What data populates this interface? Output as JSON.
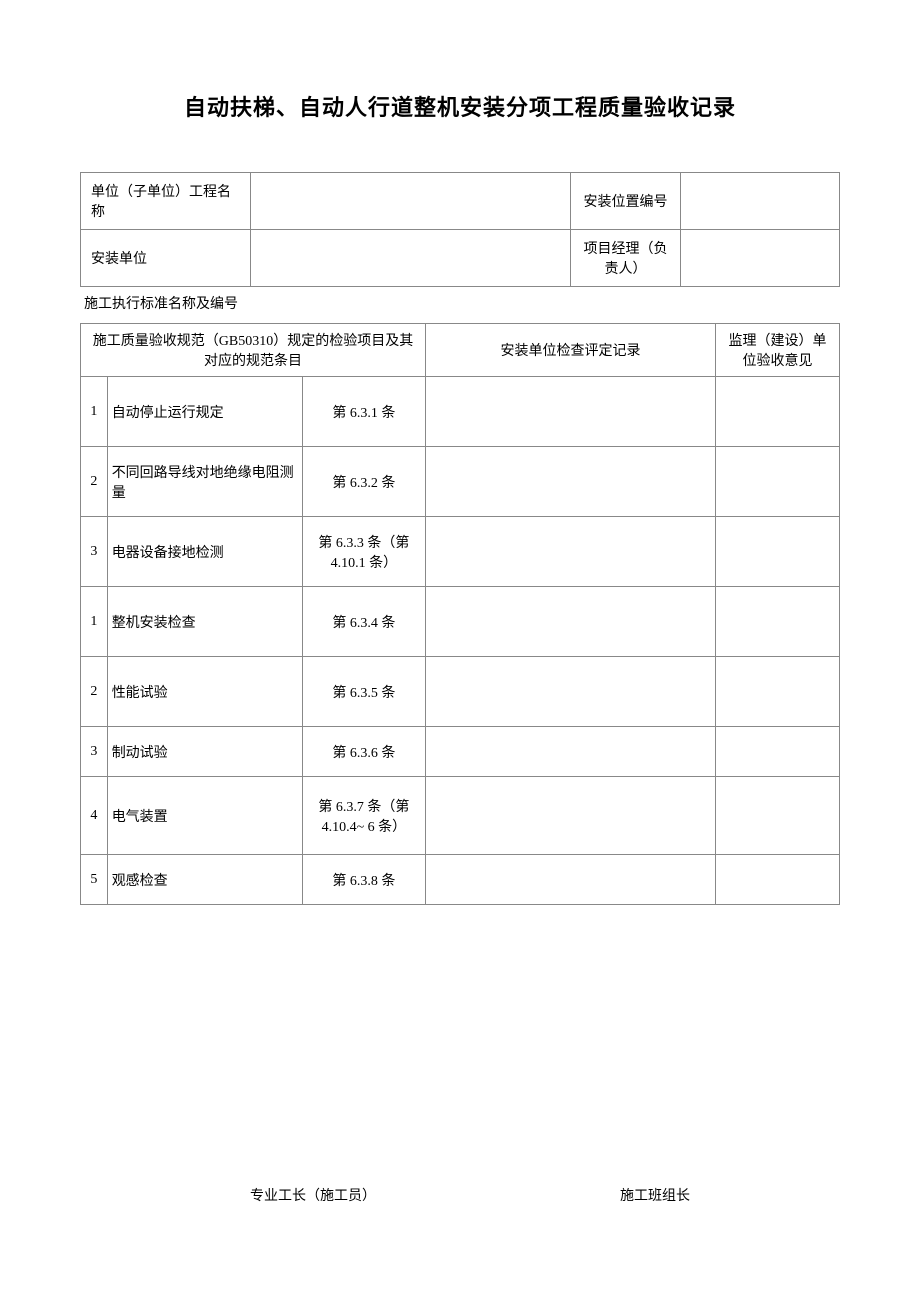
{
  "title": "自动扶梯、自动人行道整机安装分项工程质量验收记录",
  "header": {
    "row1_label1": "单位（子单位）工程名称",
    "row1_value1": "",
    "row1_label2": "安装位置编号",
    "row1_value2": "",
    "row2_label1": "安装单位",
    "row2_value1": "",
    "row2_label2": "项目经理（负责人）",
    "row2_value2": ""
  },
  "standard_line": "施工执行标准名称及编号",
  "columns": {
    "col1": "施工质量验收规范（GB50310）规定的检验项目及其对应的规范条目",
    "col2": "安装单位检查评定记录",
    "col3": "监理（建设）单位验收意见"
  },
  "rows": [
    {
      "num": "1",
      "item": "自动停止运行规定",
      "clause": "第 6.3.1 条",
      "record": "",
      "opinion": ""
    },
    {
      "num": "2",
      "item": "不同回路导线对地绝缘电阻测量",
      "clause": "第 6.3.2 条",
      "record": "",
      "opinion": ""
    },
    {
      "num": "3",
      "item": "电器设备接地检测",
      "clause": "第 6.3.3 条（第 4.10.1 条）",
      "record": "",
      "opinion": ""
    },
    {
      "num": "1",
      "item": "整机安装检查",
      "clause": "第 6.3.4 条",
      "record": "",
      "opinion": ""
    },
    {
      "num": "2",
      "item": "性能试验",
      "clause": "第 6.3.5 条",
      "record": "",
      "opinion": ""
    },
    {
      "num": "3",
      "item": "制动试验",
      "clause": "第 6.3.6 条",
      "record": "",
      "opinion": ""
    },
    {
      "num": "4",
      "item": "电气装置",
      "clause": "第 6.3.7 条（第 4.10.4~ 6 条）",
      "record": "",
      "opinion": ""
    },
    {
      "num": "5",
      "item": "观感检查",
      "clause": "第 6.3.8 条",
      "record": "",
      "opinion": ""
    }
  ],
  "footer": {
    "left": "专业工长（施工员）",
    "right": "施工班组长"
  }
}
